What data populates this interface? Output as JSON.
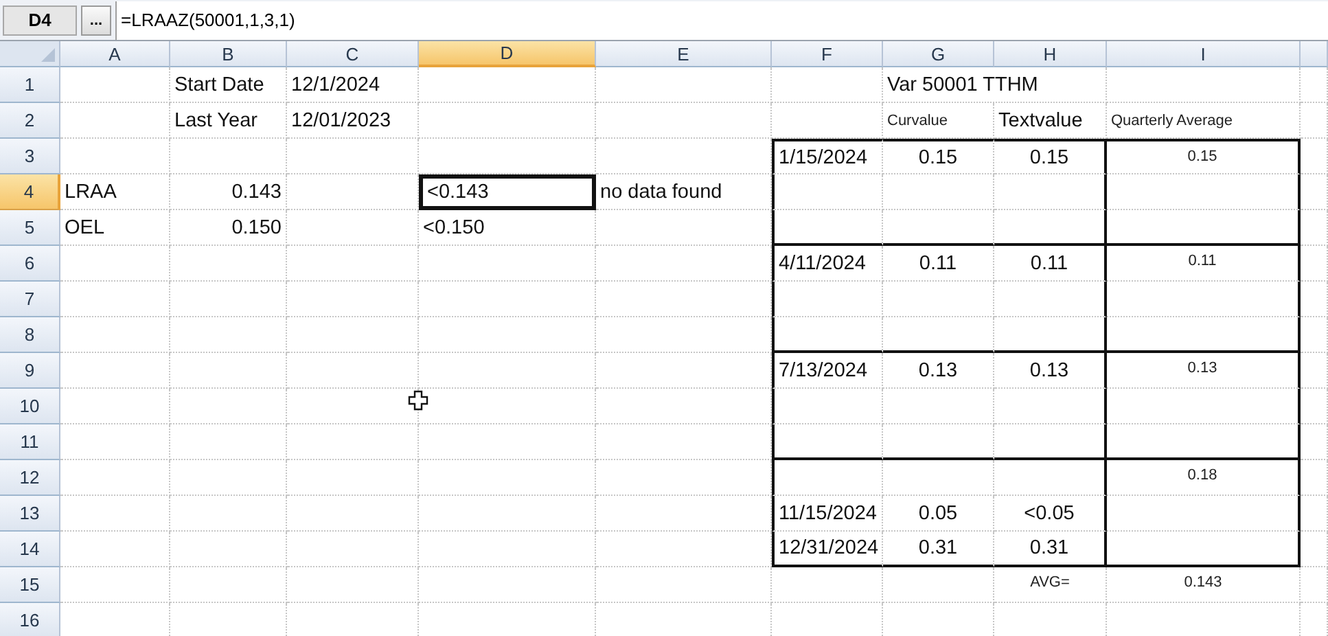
{
  "formula_bar": {
    "name_box": "D4",
    "button": "...",
    "formula": "=LRAAZ(50001,1,3,1)"
  },
  "columns": [
    {
      "label": "A",
      "selected": false
    },
    {
      "label": "B",
      "selected": false
    },
    {
      "label": "C",
      "selected": false
    },
    {
      "label": "D",
      "selected": true
    },
    {
      "label": "E",
      "selected": false
    },
    {
      "label": "F",
      "selected": false
    },
    {
      "label": "G",
      "selected": false
    },
    {
      "label": "H",
      "selected": false
    },
    {
      "label": "I",
      "selected": false
    }
  ],
  "rows": [
    {
      "label": "1",
      "selected": false,
      "cells": [
        {},
        {
          "text": "Start Date",
          "kind": "text",
          "selected": false
        },
        {
          "text": "12/1/2024",
          "kind": "text",
          "selected": false
        },
        {},
        {},
        {},
        {
          "text": "Var 50001 TTHM",
          "kind": "text",
          "selected": false
        },
        {},
        {}
      ]
    },
    {
      "label": "2",
      "selected": false,
      "cells": [
        {},
        {
          "text": "Last Year",
          "kind": "text",
          "selected": false
        },
        {
          "text": "12/01/2023",
          "kind": "text",
          "selected": false
        },
        {},
        {},
        {},
        {
          "text": "Curvalue",
          "kind": "caption",
          "selected": false
        },
        {
          "text": "Textvalue",
          "kind": "text",
          "selected": false
        },
        {
          "text": "Quarterly Average",
          "kind": "caption",
          "selected": false
        }
      ]
    },
    {
      "label": "3",
      "selected": false,
      "cells": [
        {},
        {},
        {},
        {},
        {},
        {
          "text": "1/15/2024",
          "kind": "text",
          "selected": false,
          "top_border": true,
          "left_border": true
        },
        {
          "text": "0.15",
          "kind": "value",
          "selected": false,
          "top_border": true
        },
        {
          "text": "0.15",
          "kind": "value",
          "selected": false,
          "top_border": true,
          "right_border": true
        },
        {
          "text": "0.15",
          "kind": "caption-value",
          "selected": false,
          "top_border": true,
          "right_border": true
        }
      ]
    },
    {
      "label": "4",
      "selected": true,
      "cells": [
        {
          "text": "LRAA",
          "kind": "text",
          "selected": false
        },
        {
          "text": "0.143",
          "kind": "number",
          "selected": false
        },
        {},
        {
          "text": "<0.143",
          "kind": "text",
          "selected": true
        },
        {
          "text": "no data found",
          "kind": "text",
          "selected": false
        },
        {
          "left_border": true
        },
        {},
        {
          "right_border": true
        },
        {
          "right_border": true
        }
      ]
    },
    {
      "label": "5",
      "selected": false,
      "cells": [
        {
          "text": "OEL",
          "kind": "text",
          "selected": false
        },
        {
          "text": "0.150",
          "kind": "number",
          "selected": false
        },
        {},
        {
          "text": "<0.150",
          "kind": "text",
          "selected": false
        },
        {},
        {
          "left_border": true,
          "bottom_border": true
        },
        {
          "bottom_border": true
        },
        {
          "right_border": true,
          "bottom_border": true
        },
        {
          "right_border": true,
          "bottom_border": true
        }
      ]
    },
    {
      "label": "6",
      "selected": false,
      "cells": [
        {},
        {},
        {},
        {},
        {},
        {
          "text": "4/11/2024",
          "kind": "text",
          "selected": false,
          "left_border": true
        },
        {
          "text": "0.11",
          "kind": "value",
          "selected": false
        },
        {
          "text": "0.11",
          "kind": "value",
          "selected": false,
          "right_border": true
        },
        {
          "text": "0.11",
          "kind": "caption-value",
          "selected": false,
          "right_border": true
        }
      ]
    },
    {
      "label": "7",
      "selected": false,
      "cells": [
        {},
        {},
        {},
        {},
        {},
        {
          "left_border": true
        },
        {},
        {
          "right_border": true
        },
        {
          "right_border": true
        }
      ]
    },
    {
      "label": "8",
      "selected": false,
      "cells": [
        {},
        {},
        {},
        {},
        {},
        {
          "left_border": true,
          "bottom_border": true
        },
        {
          "bottom_border": true
        },
        {
          "right_border": true,
          "bottom_border": true
        },
        {
          "right_border": true,
          "bottom_border": true
        }
      ]
    },
    {
      "label": "9",
      "selected": false,
      "cells": [
        {},
        {},
        {},
        {},
        {},
        {
          "text": "7/13/2024",
          "kind": "text",
          "selected": false,
          "left_border": true
        },
        {
          "text": "0.13",
          "kind": "value",
          "selected": false
        },
        {
          "text": "0.13",
          "kind": "value",
          "selected": false,
          "right_border": true
        },
        {
          "text": "0.13",
          "kind": "caption-value",
          "selected": false,
          "right_border": true
        }
      ]
    },
    {
      "label": "10",
      "selected": false,
      "cells": [
        {},
        {},
        {},
        {},
        {},
        {
          "left_border": true
        },
        {},
        {
          "right_border": true
        },
        {
          "right_border": true
        }
      ]
    },
    {
      "label": "11",
      "selected": false,
      "cells": [
        {},
        {},
        {},
        {},
        {},
        {
          "left_border": true,
          "bottom_border": true
        },
        {
          "bottom_border": true
        },
        {
          "right_border": true,
          "bottom_border": true
        },
        {
          "right_border": true,
          "bottom_border": true
        }
      ]
    },
    {
      "label": "12",
      "selected": false,
      "cells": [
        {},
        {},
        {},
        {},
        {},
        {
          "left_border": true
        },
        {},
        {
          "right_border": true
        },
        {
          "text": "0.18",
          "kind": "caption-value",
          "selected": false,
          "right_border": true
        }
      ]
    },
    {
      "label": "13",
      "selected": false,
      "cells": [
        {},
        {},
        {},
        {},
        {},
        {
          "text": "11/15/2024",
          "kind": "text",
          "selected": false,
          "left_border": true
        },
        {
          "text": "0.05",
          "kind": "value",
          "selected": false
        },
        {
          "text": "<0.05",
          "kind": "value",
          "selected": false,
          "right_border": true
        },
        {
          "right_border": true
        }
      ]
    },
    {
      "label": "14",
      "selected": false,
      "cells": [
        {},
        {},
        {},
        {},
        {},
        {
          "text": "12/31/2024",
          "kind": "text",
          "selected": false,
          "left_border": true,
          "bottom_border": true
        },
        {
          "text": "0.31",
          "kind": "value",
          "selected": false,
          "bottom_border": true
        },
        {
          "text": "0.31",
          "kind": "value",
          "selected": false,
          "right_border": true,
          "bottom_border": true
        },
        {
          "right_border": true,
          "bottom_border": true
        }
      ]
    },
    {
      "label": "15",
      "selected": false,
      "cells": [
        {},
        {},
        {},
        {},
        {},
        {},
        {},
        {
          "text": "AVG=",
          "kind": "caption-value",
          "selected": false
        },
        {
          "text": "0.143",
          "kind": "caption-value",
          "selected": false
        }
      ]
    },
    {
      "label": "16",
      "selected": false,
      "cells": [
        {},
        {},
        {},
        {},
        {},
        {},
        {},
        {},
        {}
      ]
    }
  ]
}
